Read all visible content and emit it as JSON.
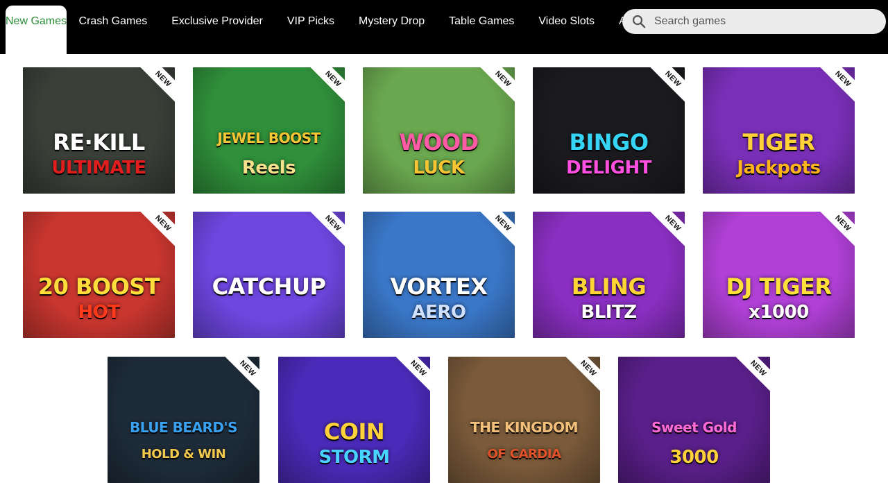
{
  "tabs": [
    {
      "label": "New Games"
    },
    {
      "label": "Crash Games"
    },
    {
      "label": "Exclusive Provider"
    },
    {
      "label": "VIP Picks"
    },
    {
      "label": "Mystery Drop"
    },
    {
      "label": "Table Games"
    },
    {
      "label": "Video Slots"
    },
    {
      "label": "All Games"
    }
  ],
  "search": {
    "placeholder": "Search games"
  },
  "badge": "NEW",
  "games": [
    {
      "line1": "RE·KILL",
      "line2": "ULTIMATE",
      "bg": "#3a3f38",
      "c1": "#ffffff",
      "c2": "#e21d1d"
    },
    {
      "line1": "JEWEL BOOST",
      "line2": "Reels",
      "bg": "#2f8f3a",
      "c1": "#f6c634",
      "c2": "#f6e08c"
    },
    {
      "line1": "WOOD",
      "line2": "LUCK",
      "bg": "#6aa84f",
      "c1": "#ff5aa5",
      "c2": "#f7c531"
    },
    {
      "line1": "BINGO",
      "line2": "DELIGHT",
      "bg": "#1b1b1f",
      "c1": "#36d5f5",
      "c2": "#ff4fe1"
    },
    {
      "line1": "TIGER",
      "line2": "Jackpots",
      "bg": "#7a2fb8",
      "c1": "#ffd23a",
      "c2": "#ffb31a"
    },
    {
      "line1": "20 BOOST",
      "line2": "HOT",
      "bg": "#c9362f",
      "c1": "#ffdd3a",
      "c2": "#ff3a1a"
    },
    {
      "line1": "CATCHUP",
      "line2": "",
      "bg": "#6e46e0",
      "c1": "#ffffff",
      "c2": "#ffffff"
    },
    {
      "line1": "VORTEX",
      "line2": "AERO",
      "bg": "#3a77c8",
      "c1": "#ffffff",
      "c2": "#cfe1ff"
    },
    {
      "line1": "BLING",
      "line2": "BLITZ",
      "bg": "#8a2fc2",
      "c1": "#ffd535",
      "c2": "#ffffff"
    },
    {
      "line1": "DJ TIGER",
      "line2": "x1000",
      "bg": "#b040d6",
      "c1": "#ffe13a",
      "c2": "#ffffff"
    },
    {
      "line1": "BLUE BEARD'S",
      "line2": "HOLD & WIN",
      "bg": "#1e2c3a",
      "c1": "#3aa0f0",
      "c2": "#f2c94c"
    },
    {
      "line1": "COIN",
      "line2": "STORM",
      "bg": "#4a2ab8",
      "c1": "#ffd23a",
      "c2": "#4ad3ff"
    },
    {
      "line1": "THE KINGDOM",
      "line2": "OF CARDIA",
      "bg": "#7a5a3a",
      "c1": "#f2c07a",
      "c2": "#e2522a"
    },
    {
      "line1": "Sweet Gold",
      "line2": "3000",
      "bg": "#5a1f8a",
      "c1": "#ff6bd8",
      "c2": "#ffd23a"
    }
  ]
}
